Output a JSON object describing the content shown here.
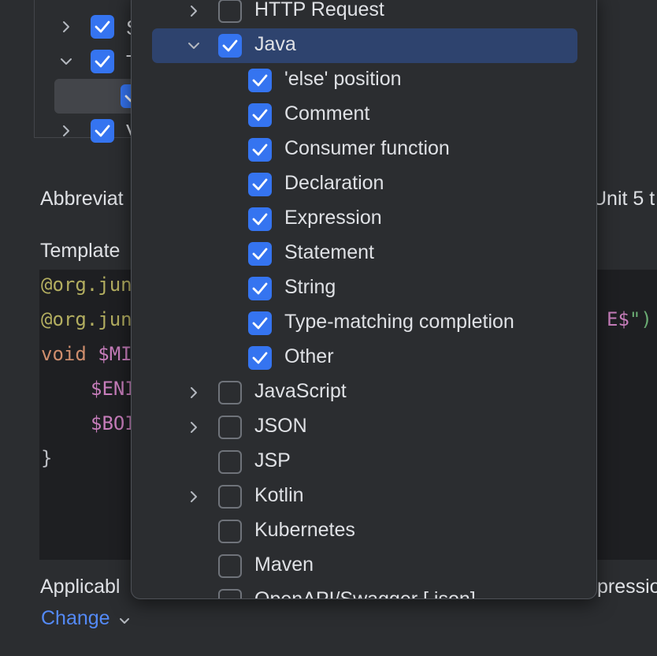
{
  "background": {
    "tree_rows": [
      {
        "letter": "S"
      },
      {
        "letter": "T"
      },
      {
        "letter": ""
      },
      {
        "letter": "V"
      }
    ],
    "abbreviation_label": "Abbreviat",
    "description_tail": "Unit 5 t",
    "template_label": "Template",
    "code_lines": {
      "l1": "@org.jun",
      "l2_start": "@org.jun",
      "l2_end_var": "E$",
      "l2_end_plain": "\")",
      "l3_kw": "void",
      "l3_var": " $MI",
      "l4_var": "$ENI",
      "l5_var": "$BOI",
      "l6": "}"
    },
    "applicable_label": "Applicabl",
    "expression_tail": "pressio",
    "change_link": "Change"
  },
  "popup": {
    "items": [
      {
        "label": "HTTP Request",
        "checked": false,
        "expandable": true
      },
      {
        "label": "Java",
        "checked": true,
        "expandable": true,
        "expanded": true,
        "selected": true
      },
      {
        "label": "'else' position",
        "checked": true,
        "child": true
      },
      {
        "label": "Comment",
        "checked": true,
        "child": true
      },
      {
        "label": "Consumer function",
        "checked": true,
        "child": true
      },
      {
        "label": "Declaration",
        "checked": true,
        "child": true
      },
      {
        "label": "Expression",
        "checked": true,
        "child": true
      },
      {
        "label": "Statement",
        "checked": true,
        "child": true
      },
      {
        "label": "String",
        "checked": true,
        "child": true
      },
      {
        "label": "Type-matching completion",
        "checked": true,
        "child": true
      },
      {
        "label": "Other",
        "checked": true,
        "child": true
      },
      {
        "label": "JavaScript",
        "checked": false,
        "expandable": true
      },
      {
        "label": "JSON",
        "checked": false,
        "expandable": true
      },
      {
        "label": "JSP",
        "checked": false,
        "expandable": false
      },
      {
        "label": "Kotlin",
        "checked": false,
        "expandable": true
      },
      {
        "label": "Kubernetes",
        "checked": false,
        "expandable": false
      },
      {
        "label": "Maven",
        "checked": false,
        "expandable": false
      },
      {
        "label": "OpenAPI/Swagger [.json]",
        "checked": false,
        "expandable": false
      }
    ]
  },
  "colors": {
    "accent": "#3574f0",
    "selection": "#2e436e",
    "background": "#2b2d30",
    "editor": "#1e1f22"
  }
}
